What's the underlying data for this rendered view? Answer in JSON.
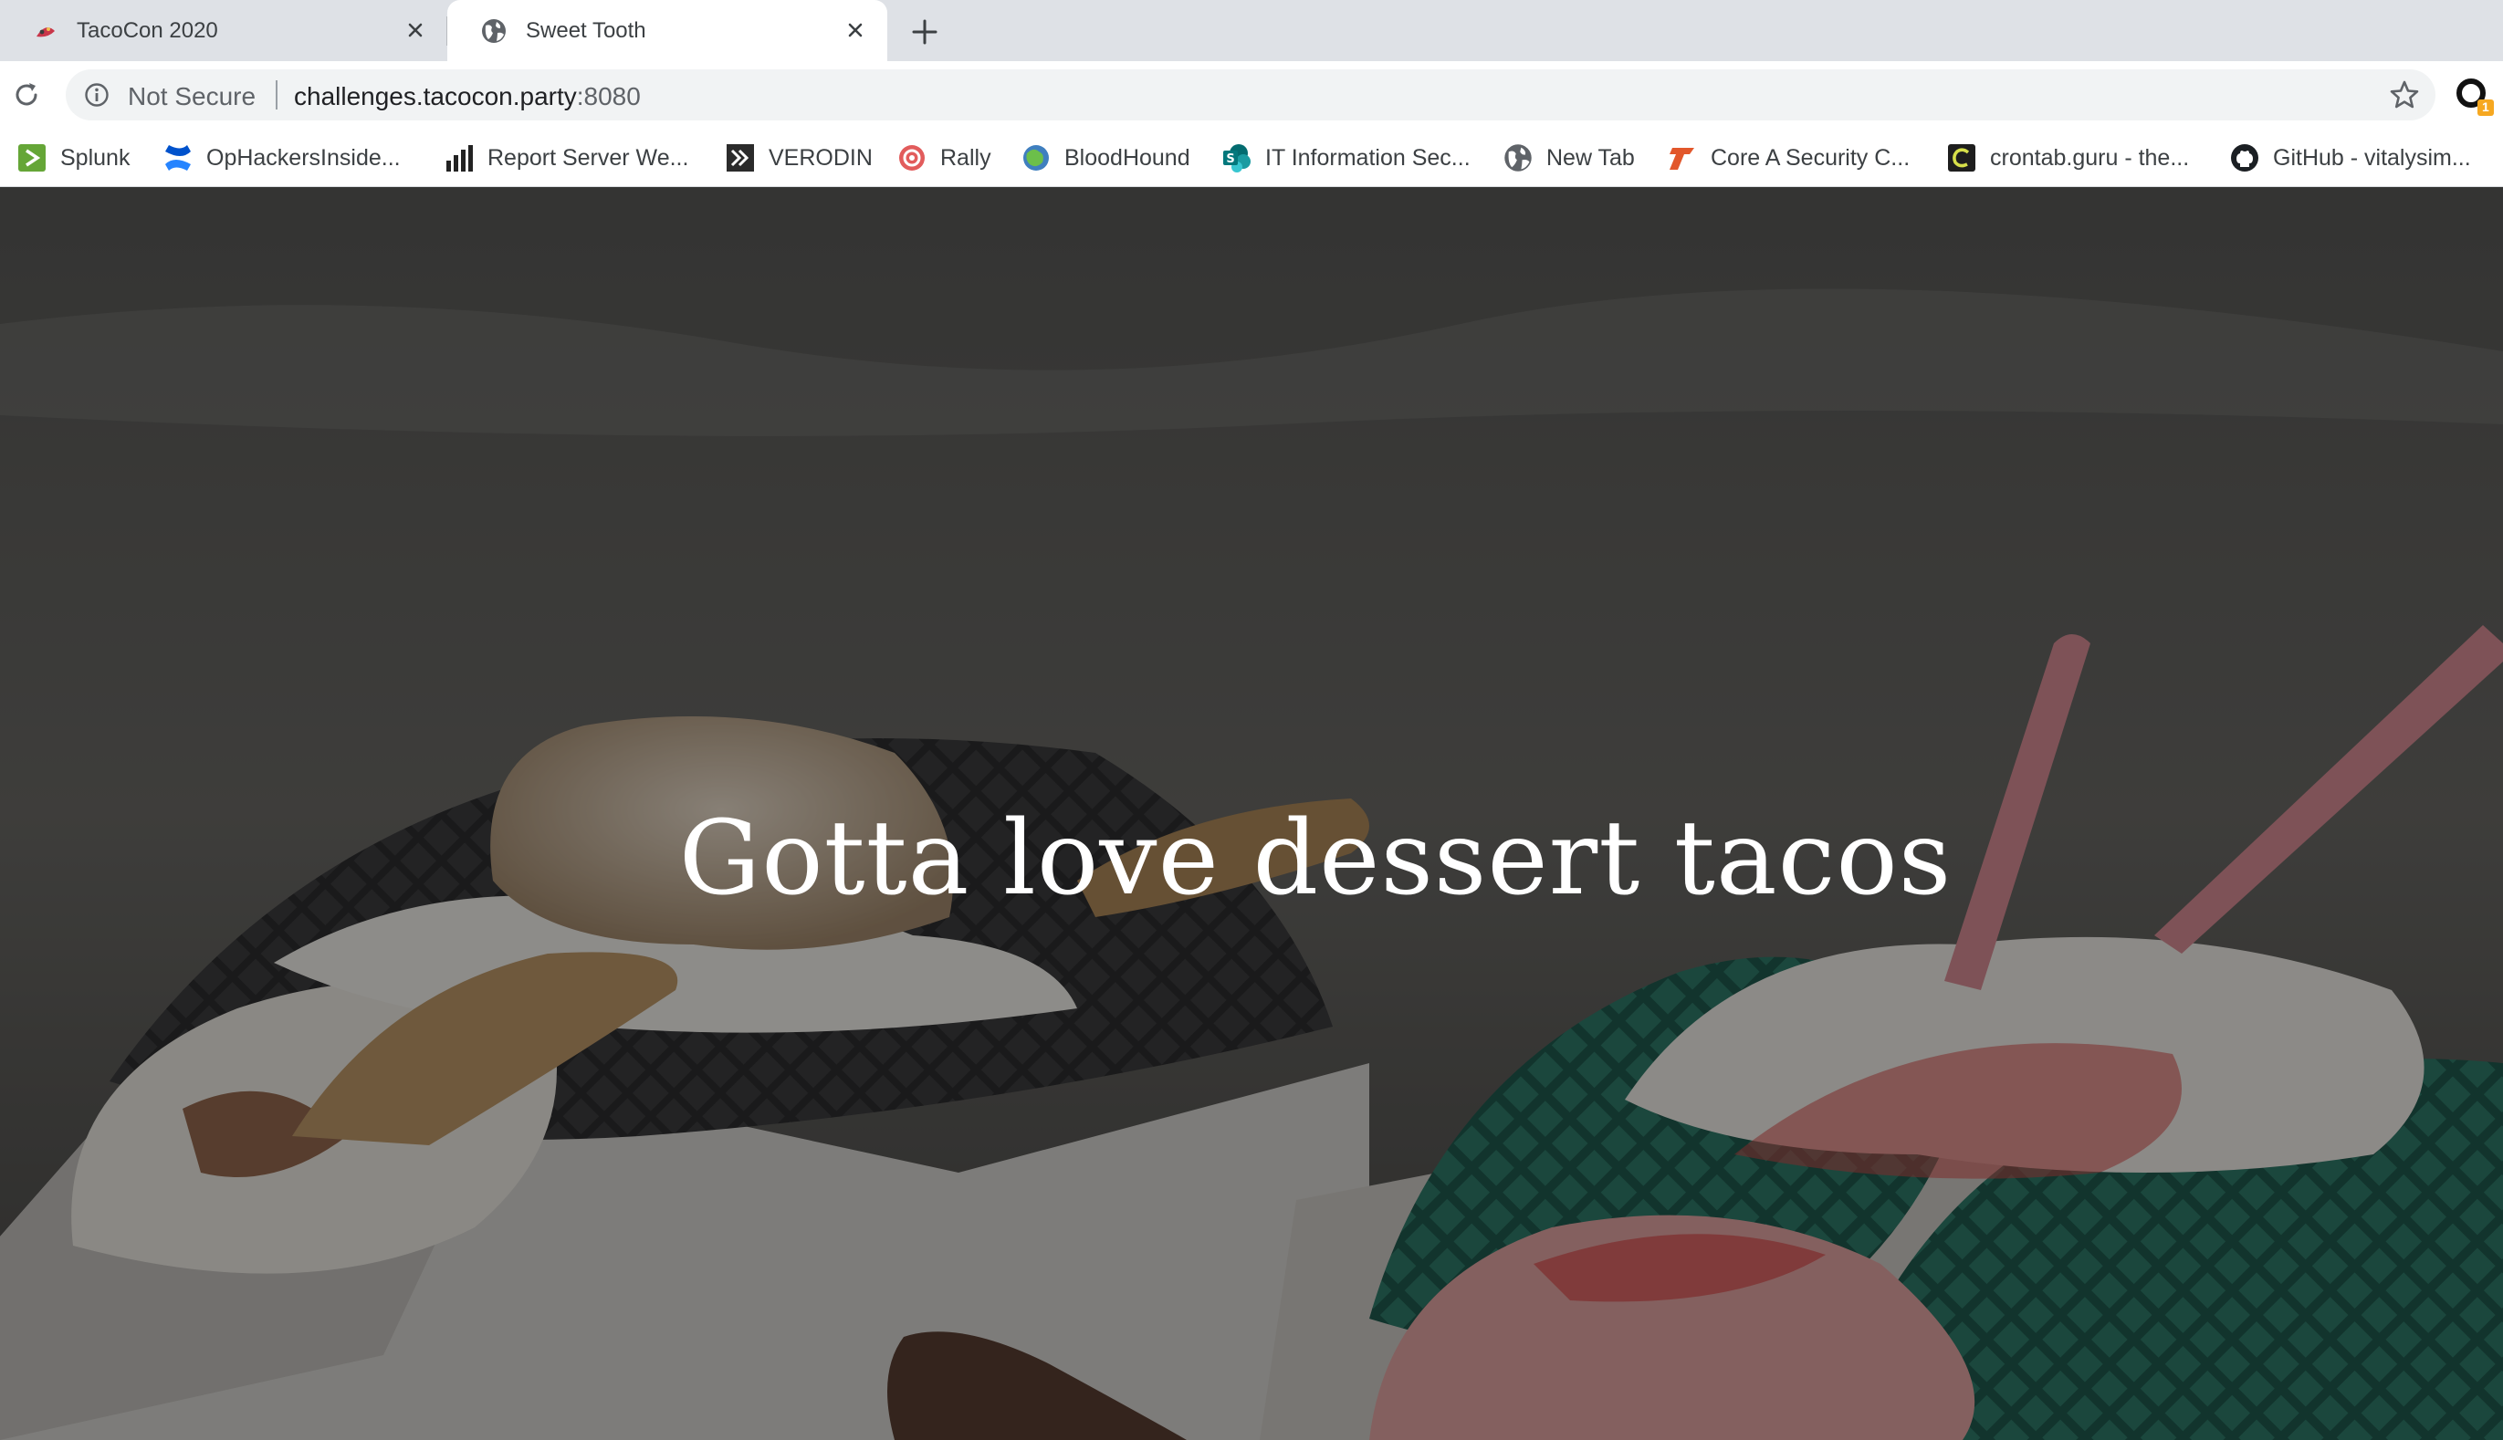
{
  "browser": {
    "tabs": [
      {
        "title": "TacoCon 2020",
        "active": false,
        "icon": "tacocon-favicon"
      },
      {
        "title": "Sweet Tooth",
        "active": true,
        "icon": "globe-icon"
      }
    ],
    "address_bar": {
      "security_label": "Not Secure",
      "host": "challenges.tacocon.party",
      "port": ":8080"
    },
    "extension_badge": "1",
    "bookmarks": [
      {
        "label": "Splunk",
        "icon": "splunk-icon"
      },
      {
        "label": "OpHackersInside...",
        "icon": "confluence-icon"
      },
      {
        "label": "Report Server We...",
        "icon": "bar-chart-icon"
      },
      {
        "label": "VERODIN",
        "icon": "verodin-icon"
      },
      {
        "label": "Rally",
        "icon": "rally-icon"
      },
      {
        "label": "BloodHound",
        "icon": "bloodhound-icon"
      },
      {
        "label": "IT Information Sec...",
        "icon": "sharepoint-icon"
      },
      {
        "label": "New Tab",
        "icon": "globe-icon"
      },
      {
        "label": "Core A Security C...",
        "icon": "core-security-icon"
      },
      {
        "label": "crontab.guru - the...",
        "icon": "crontab-icon"
      },
      {
        "label": "GitHub - vitalysim...",
        "icon": "github-icon"
      }
    ]
  },
  "page": {
    "hero_text": "Gotta love dessert tacos"
  },
  "colors": {
    "tabstrip": "#dee1e6",
    "toolbar": "#ffffff",
    "omnibox": "#f1f3f4",
    "hero_overlay": "#000000"
  }
}
